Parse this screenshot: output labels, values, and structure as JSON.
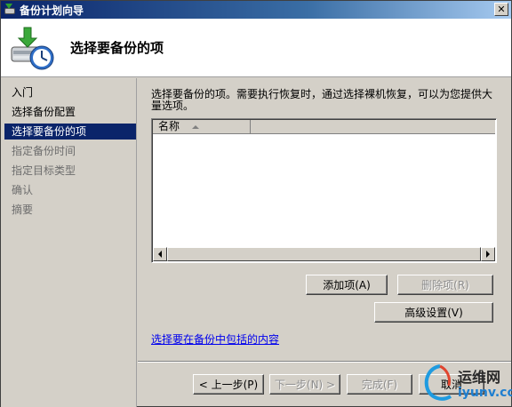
{
  "window": {
    "title": "备份计划向导",
    "close_label": "✕"
  },
  "header": {
    "title": "选择要备份的项"
  },
  "nav": {
    "items": [
      {
        "label": "入门",
        "state": "normal"
      },
      {
        "label": "选择备份配置",
        "state": "normal"
      },
      {
        "label": "选择要备份的项",
        "state": "active"
      },
      {
        "label": "指定备份时间",
        "state": "dim"
      },
      {
        "label": "指定目标类型",
        "state": "dim"
      },
      {
        "label": "确认",
        "state": "dim"
      },
      {
        "label": "摘要",
        "state": "dim"
      }
    ]
  },
  "content": {
    "intro": "选择要备份的项。需要执行恢复时，通过选择裸机恢复，可以为您提供大量选项。",
    "list": {
      "column_name": "名称",
      "rows": []
    },
    "add_button": "添加项(A)",
    "remove_button": "删除项(R)",
    "advanced_button": "高级设置(V)",
    "help_link": "选择要在备份中包括的内容"
  },
  "footer": {
    "back_button": "< 上一步(P)",
    "next_button": "下一步(N) >",
    "finish_button": "完成(F)",
    "cancel_button": "取消"
  },
  "watermark": {
    "line1": "运维网",
    "line2": "iyunv.com"
  },
  "colors": {
    "nav_active_bg": "#0a246a",
    "link": "#0000ee",
    "window_bg": "#d4d0c8"
  }
}
